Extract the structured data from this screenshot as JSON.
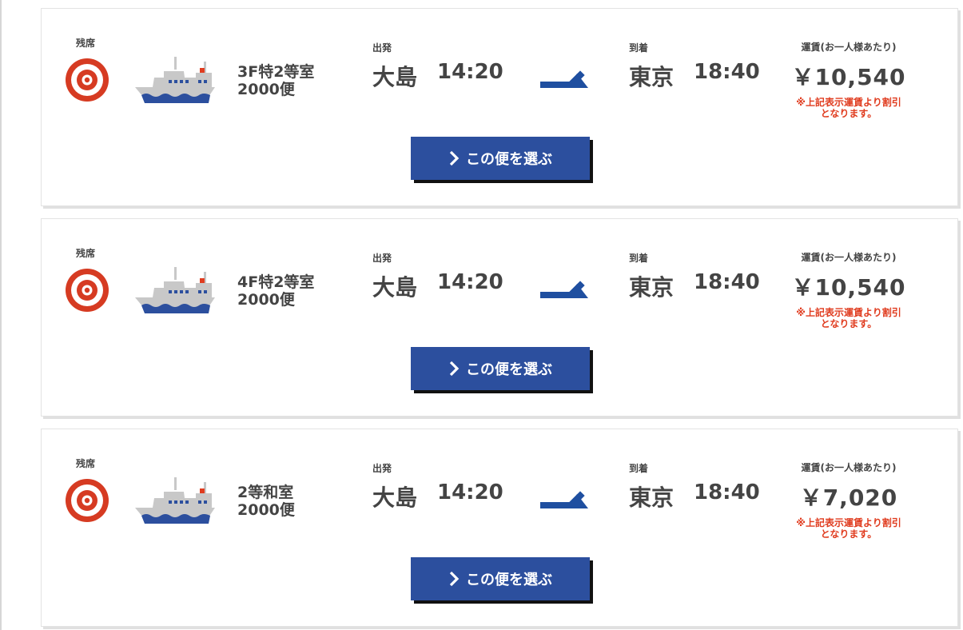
{
  "colors": {
    "button": "#2c4f9e",
    "seat_icon": "#d63b22",
    "note": "#e03c1f",
    "arrow": "#1f4fa0"
  },
  "labels": {
    "seat": "残席",
    "departure": "出発",
    "arrival": "到着",
    "fare": "運賃(お一人様あたり)",
    "note_line1": "※上記表示運賃より割引",
    "note_line2": "となります。",
    "select_button": "この便を選ぶ"
  },
  "icons": {
    "seat": "target-icon",
    "ship": "ship-icon",
    "arrow": "route-arrow-icon",
    "chevron": "chevron-right-icon"
  },
  "sailings": [
    {
      "room": "3F特2等室",
      "flight": "2000便",
      "from": "大島",
      "dep_time": "14:20",
      "to": "東京",
      "arr_time": "18:40",
      "fare": "￥10,540"
    },
    {
      "room": "4F特2等室",
      "flight": "2000便",
      "from": "大島",
      "dep_time": "14:20",
      "to": "東京",
      "arr_time": "18:40",
      "fare": "￥10,540"
    },
    {
      "room": "2等和室",
      "flight": "2000便",
      "from": "大島",
      "dep_time": "14:20",
      "to": "東京",
      "arr_time": "18:40",
      "fare": "￥7,020"
    }
  ]
}
